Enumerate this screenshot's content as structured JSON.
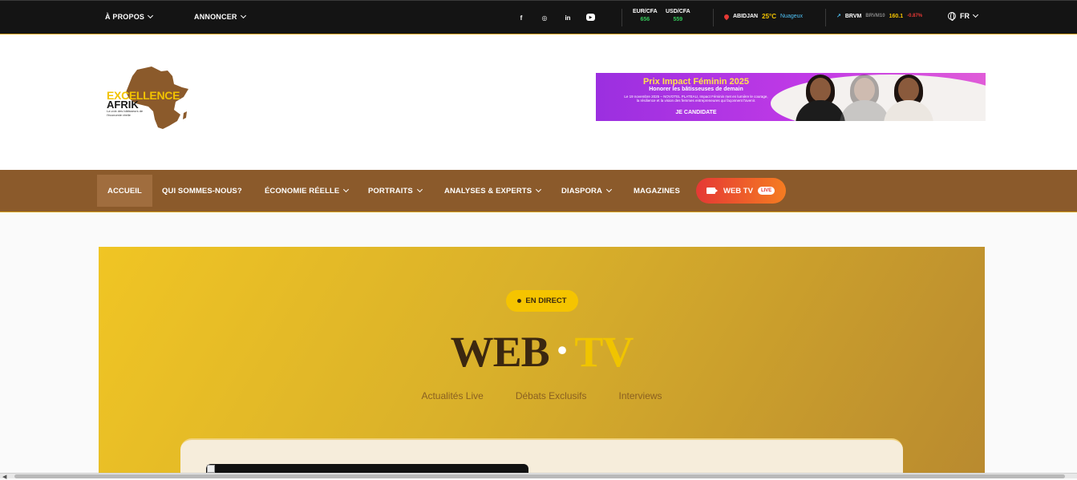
{
  "topbar": {
    "about": "À PROPOS",
    "advertise": "ANNONCER",
    "social": [
      "f",
      "◎",
      "in",
      "▶"
    ],
    "fx": [
      {
        "pair": "EUR/CFA",
        "value": "656"
      },
      {
        "pair": "USD/CFA",
        "value": "559"
      }
    ],
    "weather": {
      "city": "ABIDJAN",
      "temp": "25°C",
      "condition": "Nuageux"
    },
    "market": {
      "label": "BRVM",
      "index": "BRVM10",
      "value": "160.1",
      "change": "-0.87%"
    },
    "language": "FR"
  },
  "logo": {
    "line1": "EXCELLENCE",
    "line2": "AFRIK",
    "tagline": "La voix des bâtisseurs de l'économie réelle"
  },
  "banner": {
    "title": "Prix Impact Féminin 2025",
    "subtitle": "Honorer les bâtisseuses de demain",
    "text": "Le 19 novembre 2025 – NOVOTEL PLATEAU, Impact Féminin met en lumière le courage, la résilience et la vision des femmes entrepreneures qui façonnent l'avenir.",
    "cta": "JE CANDIDATE"
  },
  "nav": {
    "items": [
      {
        "label": "ACCUEIL"
      },
      {
        "label": "QUI SOMMES-NOUS?"
      },
      {
        "label": "ÉCONOMIE RÉELLE"
      },
      {
        "label": "PORTRAITS"
      },
      {
        "label": "ANALYSES & EXPERTS"
      },
      {
        "label": "DIASPORA"
      },
      {
        "label": "MAGAZINES"
      }
    ],
    "webtv": {
      "label": "WEB TV",
      "badge": "LIVE"
    }
  },
  "hero": {
    "live": "EN DIRECT",
    "title_left": "WEB",
    "title_sep": "•",
    "title_right": "TV",
    "tags": [
      "Actualités Live",
      "Débats Exclusifs",
      "Interviews"
    ]
  },
  "colors": {
    "topbar": "#141414",
    "nav": "#8b5a2b",
    "accent_gold": "#f0c400",
    "live_red": "#e53935"
  }
}
